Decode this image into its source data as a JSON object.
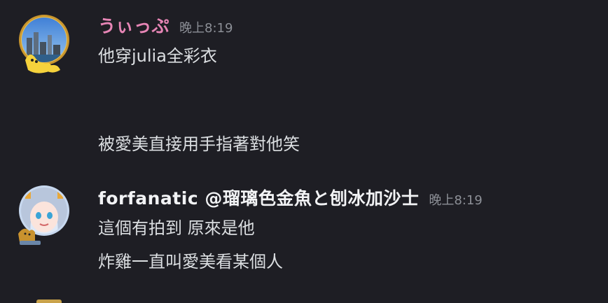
{
  "messages": [
    {
      "username": "うぃっぷ",
      "timestamp": "晚上8:19",
      "lines": [
        "他穿julia全彩衣",
        "被愛美直接用手指著對他笑"
      ]
    },
    {
      "username": "forfanatic @瑠璃色金魚と刨冰加沙士",
      "timestamp": "晚上8:19",
      "lines": [
        "這個有拍到 原來是他",
        "炸雞一直叫愛美看某個人"
      ]
    }
  ],
  "colors": {
    "background": "#1e1e24",
    "username_pink": "#e685b5",
    "username_white": "#f2f3f5",
    "timestamp": "#8c8f96",
    "message_text": "#dbdee1"
  }
}
